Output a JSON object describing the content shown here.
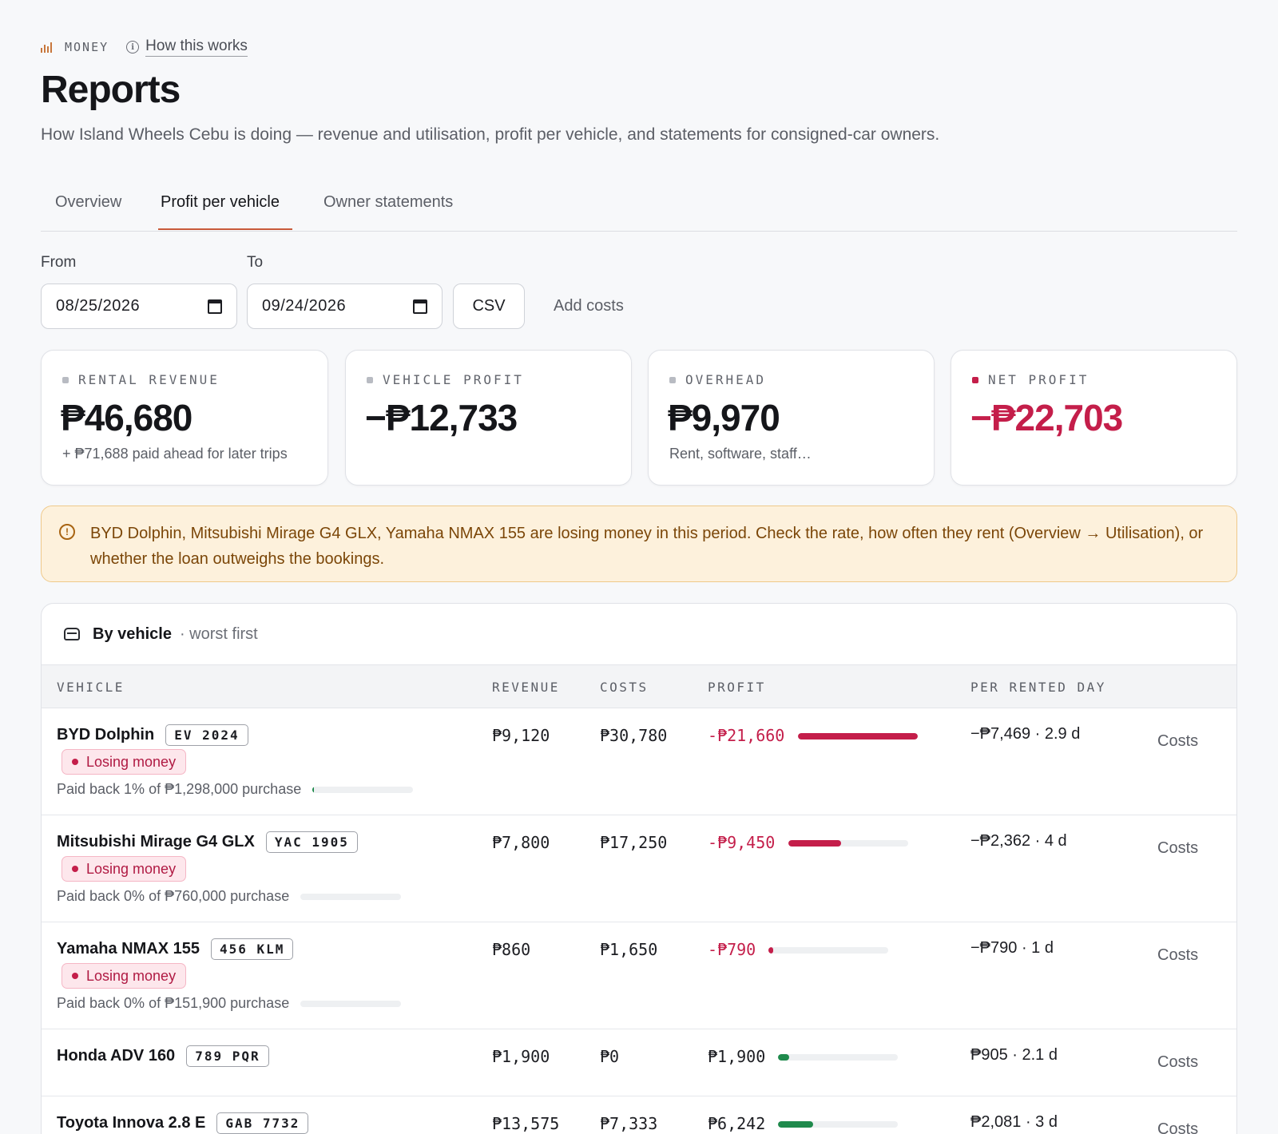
{
  "header": {
    "section_label": "MONEY",
    "how_link": "How this works",
    "title": "Reports",
    "subtitle": "How Island Wheels Cebu is doing — revenue and utilisation, profit per vehicle, and statements for consigned-car owners."
  },
  "tabs": [
    {
      "label": "Overview",
      "active": false
    },
    {
      "label": "Profit per vehicle",
      "active": true
    },
    {
      "label": "Owner statements",
      "active": false
    }
  ],
  "filters": {
    "from_label": "From",
    "from_value": "08/25/2026",
    "to_label": "To",
    "to_value": "09/24/2026",
    "csv_label": "CSV",
    "add_costs_label": "Add costs"
  },
  "kpis": [
    {
      "label": "RENTAL REVENUE",
      "value": "₱46,680",
      "note": "+ ₱71,688 paid ahead for later trips",
      "negative": false
    },
    {
      "label": "VEHICLE PROFIT",
      "value": "−₱12,733",
      "note": "",
      "negative": false
    },
    {
      "label": "OVERHEAD",
      "value": "₱9,970",
      "note": "Rent, software, staff…",
      "negative": false
    },
    {
      "label": "NET PROFIT",
      "value": "−₱22,703",
      "note": "",
      "negative": true
    }
  ],
  "alert": {
    "icon": "alert-circle-icon",
    "text": "BYD Dolphin, Mitsubishi Mirage G4 GLX, Yamaha NMAX 155 are losing money in this period. Check the rate, how often they rent (Overview → Utilisation), or whether the loan outweighs the bookings."
  },
  "table": {
    "title": "By vehicle",
    "subtitle": "· worst first",
    "columns": {
      "vehicle": "VEHICLE",
      "revenue": "REVENUE",
      "costs": "COSTS",
      "profit": "PROFIT",
      "per_day": "PER RENTED DAY"
    },
    "rows": [
      {
        "name": "BYD Dolphin",
        "plate": "EV 2024",
        "badge": "Losing money",
        "payback": "Paid back 1% of ₱1,298,000 purchase",
        "payback_fraction": 0.01,
        "revenue": "₱9,120",
        "costs": "₱30,780",
        "profit": "-₱21,660",
        "profit_fraction": 1.0,
        "profit_negative": true,
        "per_day": "−₱7,469 · 2.9 d",
        "costs_link": "Costs"
      },
      {
        "name": "Mitsubishi Mirage G4 GLX",
        "plate": "YAC 1905",
        "badge": "Losing money",
        "payback": "Paid back 0% of ₱760,000 purchase",
        "payback_fraction": 0.0,
        "revenue": "₱7,800",
        "costs": "₱17,250",
        "profit": "-₱9,450",
        "profit_fraction": 0.44,
        "profit_negative": true,
        "per_day": "−₱2,362 · 4 d",
        "costs_link": "Costs"
      },
      {
        "name": "Yamaha NMAX 155",
        "plate": "456 KLM",
        "badge": "Losing money",
        "payback": "Paid back 0% of ₱151,900 purchase",
        "payback_fraction": 0.0,
        "revenue": "₱860",
        "costs": "₱1,650",
        "profit": "-₱790",
        "profit_fraction": 0.04,
        "profit_negative": true,
        "per_day": "−₱790 · 1 d",
        "costs_link": "Costs"
      },
      {
        "name": "Honda ADV 160",
        "plate": "789 PQR",
        "badge": "",
        "payback": "",
        "payback_fraction": null,
        "revenue": "₱1,900",
        "costs": "₱0",
        "profit": "₱1,900",
        "profit_fraction": 0.09,
        "profit_negative": false,
        "per_day": "₱905 · 2.1 d",
        "costs_link": "Costs"
      },
      {
        "name": "Toyota Innova 2.8 E",
        "plate": "GAB 7732",
        "badge": "",
        "payback": "",
        "payback_fraction": null,
        "revenue": "₱13,575",
        "costs": "₱7,333",
        "profit": "₱6,242",
        "profit_fraction": 0.29,
        "profit_negative": false,
        "per_day": "₱2,081 · 3 d",
        "costs_link": "Costs"
      }
    ]
  },
  "colors": {
    "accent": "#c85a3a",
    "negative": "#c41e4a",
    "positive": "#1f8a4c",
    "alert_bg": "#fdf1dc"
  }
}
